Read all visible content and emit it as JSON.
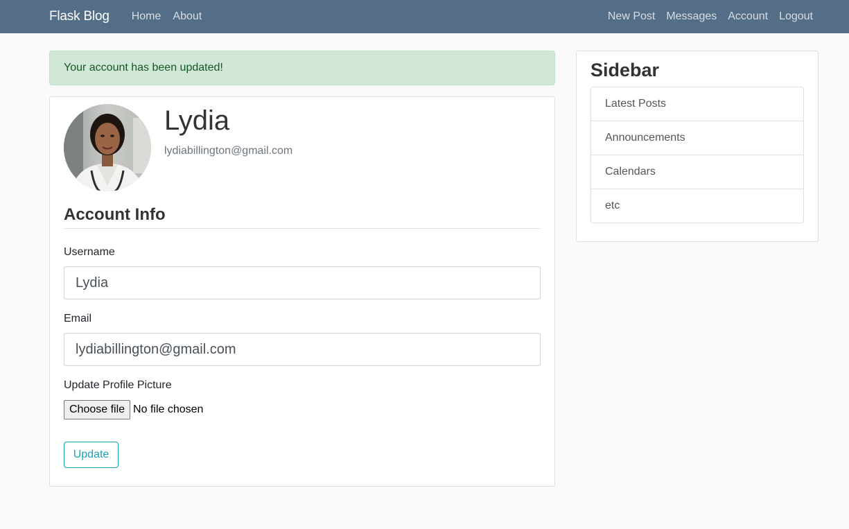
{
  "navbar": {
    "brand": "Flask Blog",
    "left_links": [
      "Home",
      "About"
    ],
    "right_links": [
      "New Post",
      "Messages",
      "Account",
      "Logout"
    ]
  },
  "alert": {
    "message": "Your account has been updated!"
  },
  "profile": {
    "name": "Lydia",
    "email": "lydiabillington@gmail.com"
  },
  "form": {
    "section_title": "Account Info",
    "username_label": "Username",
    "username_value": "Lydia",
    "email_label": "Email",
    "email_value": "lydiabillington@gmail.com",
    "picture_label": "Update Profile Picture",
    "file_button": "Choose file",
    "file_status": "No file chosen",
    "submit_label": "Update"
  },
  "sidebar": {
    "title": "Sidebar",
    "items": [
      {
        "label": "Latest Posts"
      },
      {
        "label": "Announcements"
      },
      {
        "label": "Calendars"
      },
      {
        "label": "etc"
      }
    ]
  },
  "colors": {
    "navbar_bg": "#536e86",
    "alert_bg": "#d1e8d8",
    "accent": "#17a2b8"
  }
}
